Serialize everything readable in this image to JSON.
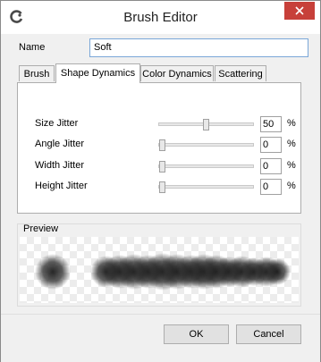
{
  "window": {
    "title": "Brush Editor"
  },
  "name_field": {
    "label": "Name",
    "value": "Soft"
  },
  "tabs": [
    {
      "label": "Brush",
      "active": false
    },
    {
      "label": "Shape Dynamics",
      "active": true
    },
    {
      "label": "Color Dynamics",
      "active": false
    },
    {
      "label": "Scattering",
      "active": false
    }
  ],
  "shape_dynamics": [
    {
      "label": "Size Jitter",
      "value": "50",
      "unit": "%",
      "level": 0.5
    },
    {
      "label": "Angle Jitter",
      "value": "0",
      "unit": "%",
      "level": 0
    },
    {
      "label": "Width Jitter",
      "value": "0",
      "unit": "%",
      "level": 0
    },
    {
      "label": "Height Jitter",
      "value": "0",
      "unit": "%",
      "level": 0
    }
  ],
  "preview": {
    "label": "Preview"
  },
  "buttons": {
    "ok": "OK",
    "cancel": "Cancel"
  },
  "colors": {
    "close_button": "#c7403a",
    "input_focus_border": "#7aa7d8"
  }
}
